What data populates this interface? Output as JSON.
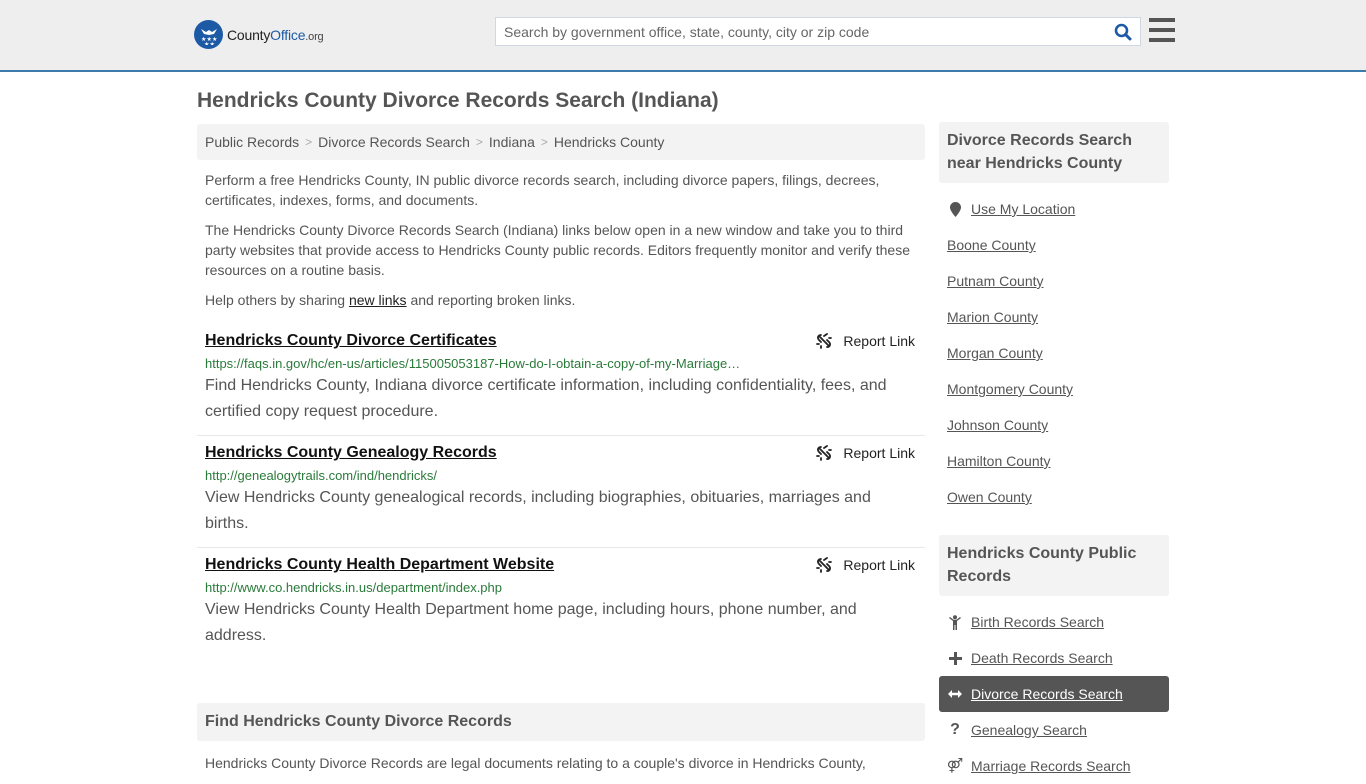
{
  "header": {
    "logo": {
      "name_a": "County",
      "name_b": "Office",
      "tld": ".org"
    },
    "search": {
      "placeholder": "Search by government office, state, county, city or zip code",
      "value": ""
    },
    "colors": {
      "brand": "#1d5aa6",
      "accent_border": "#3b7cab"
    }
  },
  "page": {
    "title": "Hendricks County Divorce Records Search (Indiana)"
  },
  "breadcrumb": [
    {
      "label": "Public Records"
    },
    {
      "label": "Divorce Records Search"
    },
    {
      "label": "Indiana"
    },
    {
      "label": "Hendricks County"
    }
  ],
  "intro": {
    "p1": "Perform a free Hendricks County, IN public divorce records search, including divorce papers, filings, decrees, certificates, indexes, forms, and documents.",
    "p2": "The Hendricks County Divorce Records Search (Indiana) links below open in a new window and take you to third party websites that provide access to Hendricks County public records. Editors frequently monitor and verify these resources on a routine basis.",
    "p3_before": "Help others by sharing ",
    "p3_link": "new links",
    "p3_after": " and reporting broken links."
  },
  "results": [
    {
      "title": "Hendricks County Divorce Certificates",
      "url": "https://faqs.in.gov/hc/en-us/articles/115005053187-How-do-I-obtain-a-copy-of-my-Marriage…",
      "description": "Find Hendricks County, Indiana divorce certificate information, including confidentiality, fees, and certified copy request procedure.",
      "report_label": "Report Link"
    },
    {
      "title": "Hendricks County Genealogy Records",
      "url": "http://genealogytrails.com/ind/hendricks/",
      "description": "View Hendricks County genealogical records, including biographies, obituaries, marriages and births.",
      "report_label": "Report Link"
    },
    {
      "title": "Hendricks County Health Department Website",
      "url": "http://www.co.hendricks.in.us/department/index.php",
      "description": "View Hendricks County Health Department home page, including hours, phone number, and address.",
      "report_label": "Report Link"
    }
  ],
  "find_section": {
    "heading": "Find Hendricks County Divorce Records",
    "text": "Hendricks County Divorce Records are legal documents relating to a couple's divorce in Hendricks County,"
  },
  "sidebar": {
    "nearby": {
      "heading": "Divorce Records Search near Hendricks County",
      "use_location": "Use My Location",
      "counties": [
        "Boone County",
        "Putnam County",
        "Marion County",
        "Morgan County",
        "Montgomery County",
        "Johnson County",
        "Hamilton County",
        "Owen County"
      ]
    },
    "public_records": {
      "heading": "Hendricks County Public Records",
      "items": [
        {
          "label": "Birth Records Search",
          "icon": "child-icon",
          "glyph": "🯅"
        },
        {
          "label": "Death Records Search",
          "icon": "plus-icon",
          "glyph": "+"
        },
        {
          "label": "Divorce Records Search",
          "icon": "arrows-horizontal-icon",
          "glyph": "↔",
          "active": true
        },
        {
          "label": "Genealogy Search",
          "icon": "question-icon",
          "glyph": "?"
        },
        {
          "label": "Marriage Records Search",
          "icon": "venus-mars-icon",
          "glyph": "⚤"
        }
      ]
    }
  }
}
